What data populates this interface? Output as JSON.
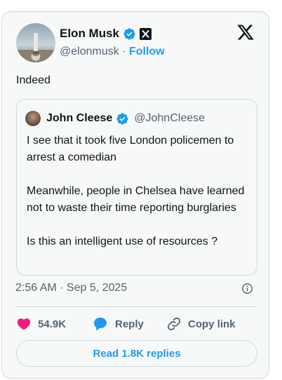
{
  "author": {
    "name": "Elon Musk",
    "handle": "@elonmusk",
    "separator": "·",
    "follow_label": "Follow",
    "verified_icon": "verified-badge-icon",
    "affiliation_icon": "x-affiliation-icon"
  },
  "logo_icon": "x-logo-icon",
  "tweet": {
    "text": "Indeed"
  },
  "quoted_tweet": {
    "name": "John Cleese",
    "handle": "@JohnCleese",
    "paragraphs": [
      "I see that it took five London policemen to arrest a comedian",
      "Meanwhile, people in Chelsea have learned not to waste their time reporting burglaries",
      "Is this an intelligent use of resources ?"
    ]
  },
  "meta": {
    "timestamp": "2:56 AM · Sep 5, 2025",
    "info_icon": "info-icon"
  },
  "actions": {
    "likes": "54.9K",
    "reply_label": "Reply",
    "copy_link_label": "Copy link"
  },
  "read_replies_label": "Read 1.8K replies",
  "colors": {
    "accent": "#1d9bf0",
    "like": "#f91880",
    "secondary_text": "#536471",
    "border": "#cfd9de",
    "background": "#f7f9f9"
  }
}
